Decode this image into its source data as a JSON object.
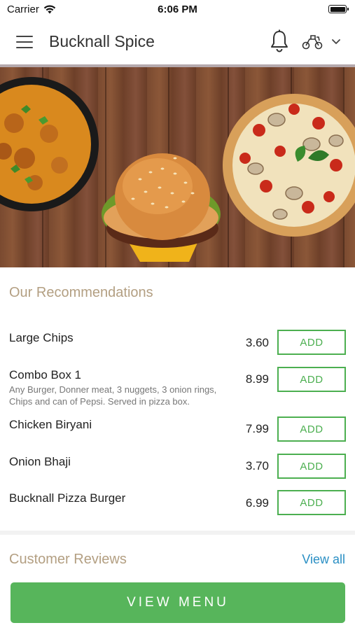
{
  "status_bar": {
    "carrier": "Carrier",
    "time": "6:06 PM",
    "icons": [
      "wifi-icon",
      "battery-icon"
    ]
  },
  "header": {
    "title": "Bucknall Spice",
    "icons": [
      "menu-icon",
      "bell-icon",
      "delivery-scooter-icon",
      "chevron-down-icon"
    ]
  },
  "hero": {
    "description_icons": [
      "curry-bowl",
      "burger",
      "pizza"
    ]
  },
  "recommendations": {
    "title": "Our Recommendations",
    "add_label": "ADD",
    "items": [
      {
        "name": "Large Chips",
        "description": "",
        "price": "3.60"
      },
      {
        "name": "Combo Box 1",
        "description": "Any Burger, Donner meat, 3 nuggets, 3 onion rings, Chips and can of Pepsi. Served in pizza box.",
        "price": "8.99"
      },
      {
        "name": "Chicken Biryani",
        "description": "",
        "price": "7.99"
      },
      {
        "name": "Onion Bhaji",
        "description": "",
        "price": "3.70"
      },
      {
        "name": "Bucknall Pizza Burger",
        "description": "",
        "price": "6.99"
      }
    ]
  },
  "reviews": {
    "title": "Customer Reviews",
    "view_all": "View all"
  },
  "footer": {
    "view_menu": "VIEW MENU"
  },
  "colors": {
    "accent_green": "#57b55b",
    "add_green": "#4caf50",
    "section_title": "#b39f82",
    "link_blue": "#2a8fc4"
  }
}
